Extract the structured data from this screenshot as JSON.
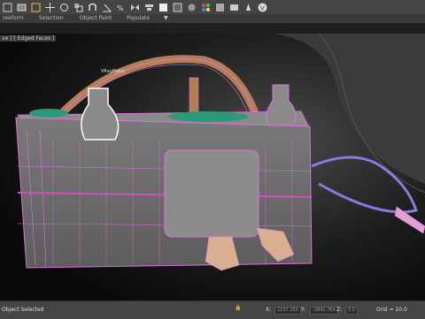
{
  "ribbon": {
    "tab1": "reeform",
    "tab2": "Selection",
    "tab3": "Object Paint",
    "tab4": "Populate"
  },
  "viewport": {
    "label": "ve ] [ Edged Faces ]",
    "object_label": "VRayPlane"
  },
  "status": {
    "message": "Object Selected",
    "x_label": "X:",
    "x_value": "2237.255",
    "y_label": "Y:",
    "y_value": "-3841.764",
    "z_label": "Z:",
    "z_value": "0.0",
    "grid": "Grid = 10.0"
  },
  "colors": {
    "wire": "#e070e0",
    "body": "#6a6a6a",
    "selection": "#ffffff"
  }
}
